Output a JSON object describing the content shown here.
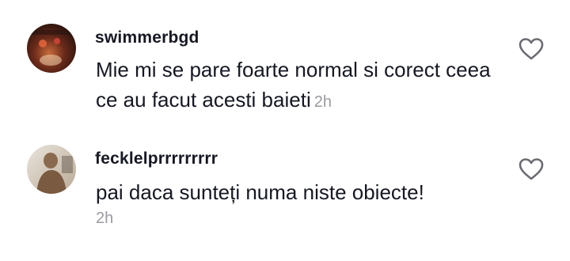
{
  "comments": [
    {
      "username": "swimmerbgd",
      "text": "Mie mi se pare foarte normal si corect ceea ce au facut acesti baieti",
      "time": "2h",
      "like_icon": "heart-outline-icon"
    },
    {
      "username": "fecklelprrrrrrrrr",
      "text": "pai daca sunteți numa niste obiecte!",
      "time": "2h",
      "like_icon": "heart-outline-icon"
    }
  ],
  "colors": {
    "text": "#161823",
    "muted": "#9a9ba1",
    "icon": "#6b6c72"
  }
}
